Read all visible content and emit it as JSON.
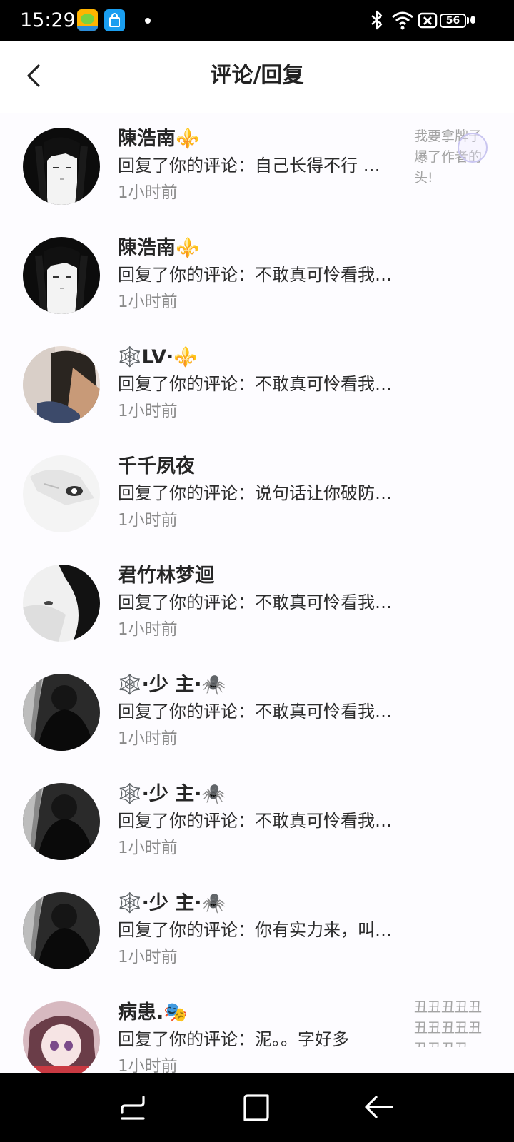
{
  "status_bar": {
    "time": "15:29",
    "battery": "56"
  },
  "header": {
    "title": "评论/回复"
  },
  "notifications": [
    {
      "name": "陳浩南",
      "badge": "⚜️",
      "reply": "回复了你的评论：自己长得不行 评论别人长得丑",
      "time": "1小时前",
      "preview": "我要拿牌子爆了作者的头!",
      "avatar": "anime-girl-bw"
    },
    {
      "name": "陳浩南",
      "badge": "⚜️",
      "reply": "回复了你的评论：不敢真可怜看我把你吓的",
      "time": "1小时前",
      "preview": "",
      "avatar": "anime-girl-bw"
    },
    {
      "name": "🕸️LV·",
      "badge": "⚜️",
      "reply": "回复了你的评论：不敢真可怜看我把你吓的",
      "time": "1小时前",
      "preview": "",
      "avatar": "dark-hair-photo"
    },
    {
      "name": "千千夙夜",
      "badge": "",
      "reply": "回复了你的评论：说句话让你破防了吗",
      "time": "1小时前",
      "preview": "",
      "avatar": "pale-face-sketch"
    },
    {
      "name": "君竹林梦迴",
      "badge": "",
      "reply": "回复了你的评论：不敢真可怜看我把你吓的",
      "time": "1小时前",
      "preview": "",
      "avatar": "lying-girl-bw"
    },
    {
      "name": "🕸️·少 主·",
      "badge": "🕷️",
      "reply": "回复了你的评论：不敢真可怜看我把你吓的",
      "time": "1小时前",
      "preview": "",
      "avatar": "man-dark-bw"
    },
    {
      "name": "🕸️·少 主·",
      "badge": "🕷️",
      "reply": "回复了你的评论：不敢真可怜看我把你吓的",
      "time": "1小时前",
      "preview": "",
      "avatar": "man-dark-bw"
    },
    {
      "name": "🕸️·少 主·",
      "badge": "🕷️",
      "reply": "回复了你的评论：你有实力来，叫你看看",
      "time": "1小时前",
      "preview": "",
      "avatar": "man-dark-bw"
    },
    {
      "name": "病患.",
      "badge": "🎭",
      "reply": "回复了你的评论：泥。。字好多",
      "time": "1小时前",
      "preview": "丑丑丑丑丑丑丑丑丑丑丑丑丑丑",
      "avatar": "anime-girl-red"
    }
  ]
}
